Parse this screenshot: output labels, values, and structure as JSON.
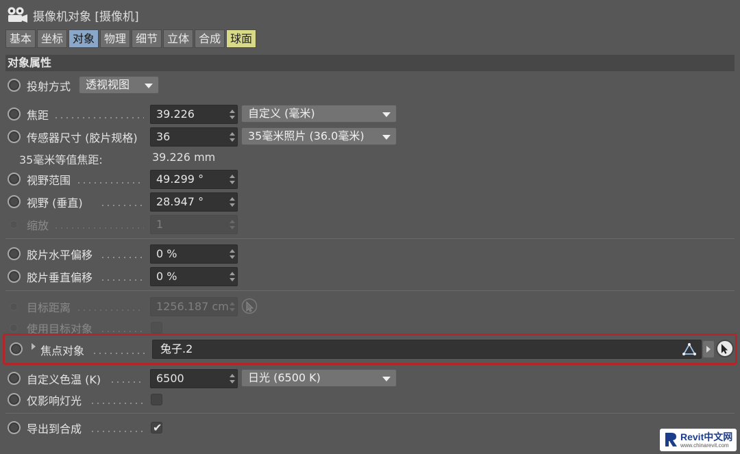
{
  "title": "摄像机对象 [摄像机]",
  "tabs": [
    {
      "label": "基本",
      "state": "normal"
    },
    {
      "label": "坐标",
      "state": "normal"
    },
    {
      "label": "对象",
      "state": "active"
    },
    {
      "label": "物理",
      "state": "normal"
    },
    {
      "label": "细节",
      "state": "normal"
    },
    {
      "label": "立体",
      "state": "normal"
    },
    {
      "label": "合成",
      "state": "normal"
    },
    {
      "label": "球面",
      "state": "highlight"
    }
  ],
  "section_title": "对象属性",
  "projection": {
    "label": "投射方式",
    "value": "透视视图"
  },
  "focal_length": {
    "label": "焦距",
    "value": "39.226",
    "unit_option": "自定义 (毫米)"
  },
  "sensor_size": {
    "label": "传感器尺寸 (胶片规格)",
    "value": "36",
    "preset": "35毫米照片 (36.0毫米)"
  },
  "equiv_focal": {
    "label": "35毫米等值焦距:",
    "value": "39.226 mm"
  },
  "fov": {
    "label": "视野范围",
    "value": "49.299 °"
  },
  "fov_vertical": {
    "label": "视野 (垂直)",
    "value": "28.947 °"
  },
  "zoom": {
    "label": "缩放",
    "value": "1"
  },
  "film_h_offset": {
    "label": "胶片水平偏移",
    "value": "0 %"
  },
  "film_v_offset": {
    "label": "胶片垂直偏移",
    "value": "0 %"
  },
  "target_distance": {
    "label": "目标距离",
    "value": "1256.187 cm"
  },
  "use_target": {
    "label": "使用目标对象",
    "checked": false
  },
  "focus_object": {
    "label": "焦点对象",
    "value": "兔子.2"
  },
  "color_temp": {
    "label": "自定义色温 (K)",
    "value": "6500",
    "preset": "日光 (6500 K)"
  },
  "affect_lights_only": {
    "label": "仅影响灯光",
    "checked": false
  },
  "export_to_compositing": {
    "label": "导出到合成",
    "checked": true
  },
  "watermark": {
    "brand": "Revit中文网",
    "url": "www.chinarevit.com"
  },
  "colors": {
    "accent_tab": "#8aa6c8",
    "highlight_tab": "#d9d98a",
    "focus_outline": "#b4252a",
    "background": "#575757"
  }
}
